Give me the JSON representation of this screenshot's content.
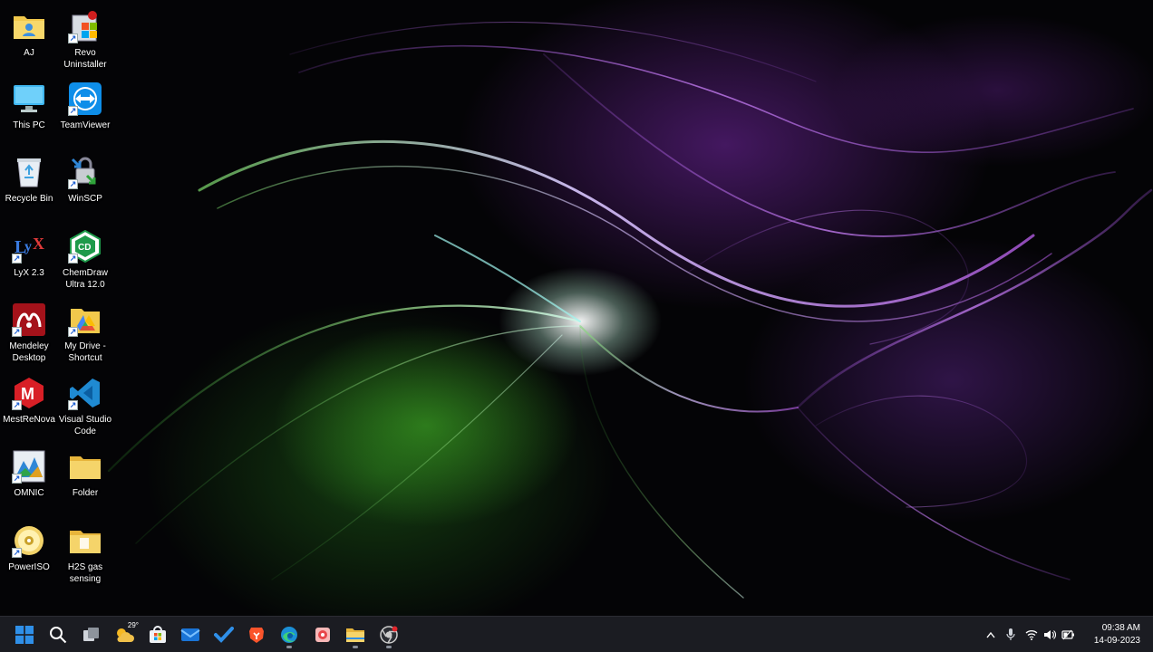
{
  "desktop": {
    "icons": [
      {
        "id": "aj",
        "label": "AJ"
      },
      {
        "id": "revo",
        "label": "Revo\nUninstaller"
      },
      {
        "id": "this-pc",
        "label": "This PC"
      },
      {
        "id": "teamviewer",
        "label": "TeamViewer"
      },
      {
        "id": "recycle-bin",
        "label": "Recycle Bin"
      },
      {
        "id": "winscp",
        "label": "WinSCP"
      },
      {
        "id": "lyx",
        "label": "LyX 2.3"
      },
      {
        "id": "chemdraw",
        "label": "ChemDraw\nUltra 12.0"
      },
      {
        "id": "mendeley",
        "label": "Mendeley\nDesktop"
      },
      {
        "id": "mydrive",
        "label": "My Drive -\nShortcut"
      },
      {
        "id": "mestrenova",
        "label": "MestReNova"
      },
      {
        "id": "vscode",
        "label": "Visual Studio\nCode"
      },
      {
        "id": "omnic",
        "label": "OMNIC"
      },
      {
        "id": "folder",
        "label": "Folder"
      },
      {
        "id": "poweriso",
        "label": "PowerISO"
      },
      {
        "id": "h2s",
        "label": "H2S gas\nsensing"
      }
    ]
  },
  "taskbar": {
    "weather_temp": "29°",
    "clock_time": "09:38 AM",
    "clock_date": "14-09-2023",
    "icons": [
      "windows-start-icon",
      "search-icon",
      "task-view-icon",
      "weather-icon",
      "microsoft-store-icon",
      "mail-icon",
      "todo-icon",
      "brave-browser-icon",
      "edge-browser-icon",
      "app-icon",
      "file-explorer-icon",
      "chrome-icon"
    ],
    "tray_icons": [
      "chevron-up-icon",
      "microphone-icon",
      "wifi-icon",
      "volume-icon",
      "battery-icon"
    ]
  },
  "colors": {
    "taskbar_bg": "#1b1c22",
    "accent_blue": "#2f8fe8",
    "folder_yellow": "#f2c94c"
  }
}
